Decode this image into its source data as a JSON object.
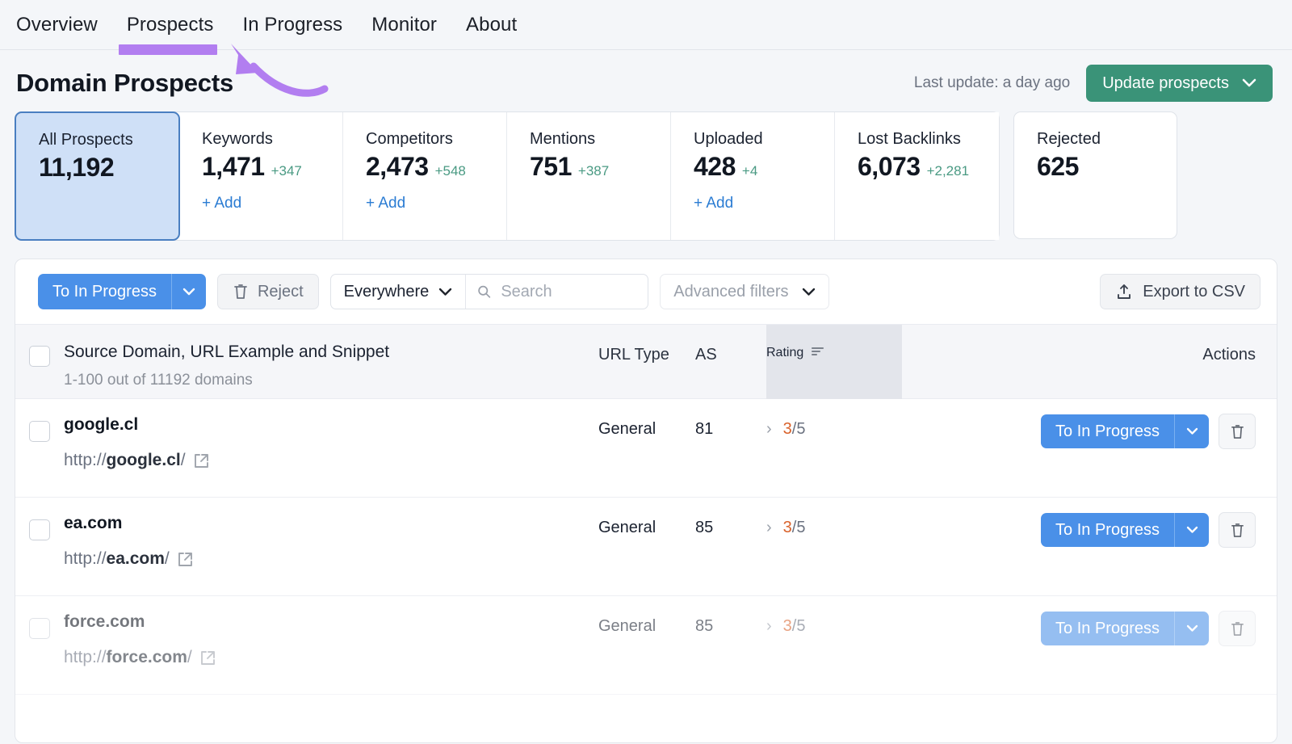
{
  "nav": {
    "items": [
      {
        "label": "Overview"
      },
      {
        "label": "Prospects"
      },
      {
        "label": "In Progress"
      },
      {
        "label": "Monitor"
      },
      {
        "label": "About"
      }
    ],
    "active": "Prospects"
  },
  "header": {
    "title": "Domain Prospects",
    "last_update": "Last update: a day ago",
    "update_button": "Update prospects"
  },
  "cards": [
    {
      "label": "All Prospects",
      "value": "11,192",
      "delta": "",
      "add": "",
      "selected": true
    },
    {
      "label": "Keywords",
      "value": "1,471",
      "delta": "+347",
      "add": "+ Add",
      "selected": false
    },
    {
      "label": "Competitors",
      "value": "2,473",
      "delta": "+548",
      "add": "+ Add",
      "selected": false
    },
    {
      "label": "Mentions",
      "value": "751",
      "delta": "+387",
      "add": "",
      "selected": false
    },
    {
      "label": "Uploaded",
      "value": "428",
      "delta": "+4",
      "add": "+ Add",
      "selected": false
    },
    {
      "label": "Lost Backlinks",
      "value": "6,073",
      "delta": "+2,281",
      "add": "",
      "selected": false
    },
    {
      "label": "Rejected",
      "value": "625",
      "delta": "",
      "add": "",
      "selected": false
    }
  ],
  "toolbar": {
    "to_in_progress": "To In Progress",
    "reject": "Reject",
    "scope": "Everywhere",
    "search_placeholder": "Search",
    "search_value": "",
    "advanced_filters": "Advanced filters",
    "export": "Export to CSV"
  },
  "table": {
    "head": {
      "domain": "Source Domain, URL Example and Snippet",
      "domain_sub": "1-100 out of 11192 domains",
      "url_type": "URL Type",
      "as": "AS",
      "rating": "Rating",
      "actions": "Actions"
    },
    "rows": [
      {
        "domain": "google.cl",
        "url_prefix": "http://",
        "url_bold": "google.cl",
        "url_suffix": "/",
        "url_type": "General",
        "as": "81",
        "rating_num": "3",
        "rating_den": "/5",
        "action": "To In Progress"
      },
      {
        "domain": "ea.com",
        "url_prefix": "http://",
        "url_bold": "ea.com",
        "url_suffix": "/",
        "url_type": "General",
        "as": "85",
        "rating_num": "3",
        "rating_den": "/5",
        "action": "To In Progress"
      },
      {
        "domain": "force.com",
        "url_prefix": "http://",
        "url_bold": "force.com",
        "url_suffix": "/",
        "url_type": "General",
        "as": "85",
        "rating_num": "3",
        "rating_den": "/5",
        "action": "To In Progress"
      }
    ]
  },
  "colors": {
    "annotation_purple": "#b27ef0",
    "primary_blue": "#4a90e8",
    "green": "#3a9378",
    "rating_orange": "#d9622b",
    "selected_card_bg": "#cfe0f7",
    "page_bg": "#f4f6f9"
  }
}
